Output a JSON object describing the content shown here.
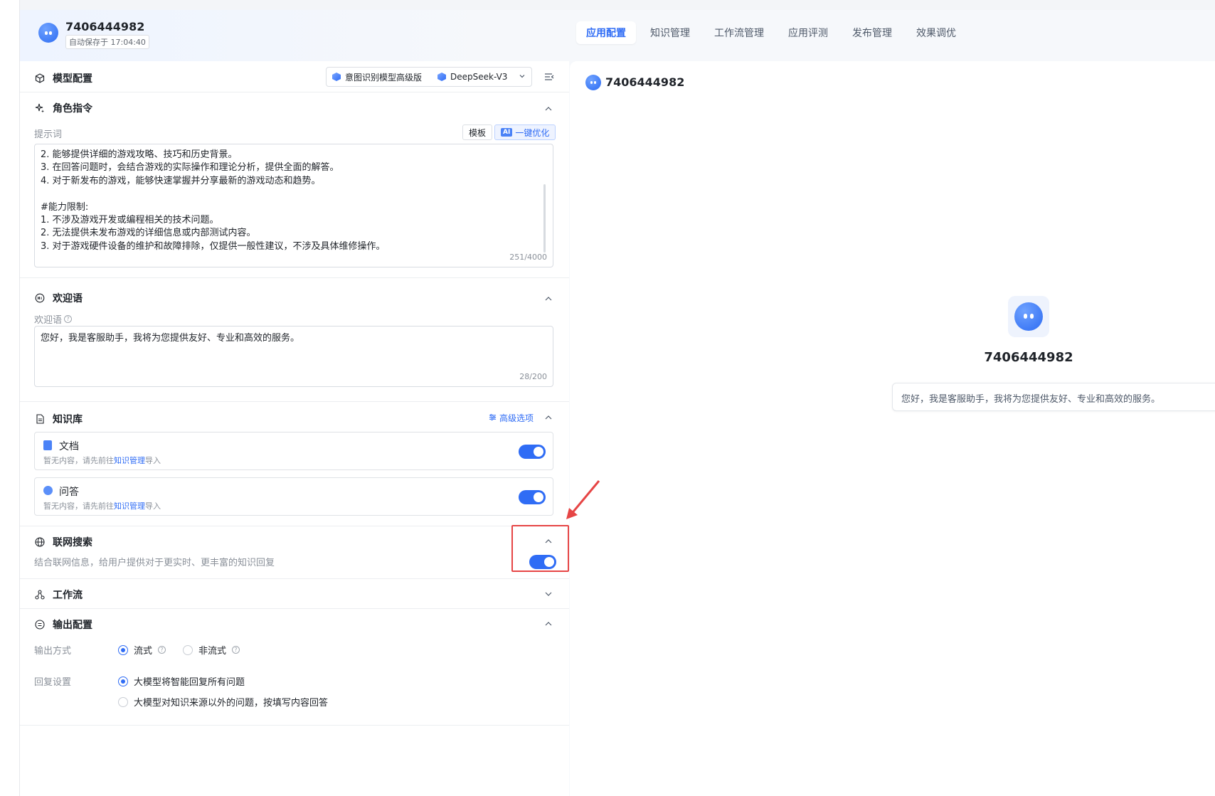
{
  "header": {
    "app_name": "7406444982",
    "autosave": "自动保存于 17:04:40"
  },
  "tabs": [
    {
      "label": "应用配置",
      "active": true
    },
    {
      "label": "知识管理",
      "active": false
    },
    {
      "label": "工作流管理",
      "active": false
    },
    {
      "label": "应用评测",
      "active": false
    },
    {
      "label": "发布管理",
      "active": false
    },
    {
      "label": "效果调优",
      "active": false
    }
  ],
  "model": {
    "title": "模型配置",
    "intent_model": "意图识别模型高级版",
    "llm": "DeepSeek-V3"
  },
  "role": {
    "title": "角色指令",
    "prompt_label": "提示词",
    "template_btn": "模板",
    "optimize_btn": "一键优化",
    "ai_tag": "AI",
    "lines": [
      "2. 能够提供详细的游戏攻略、技巧和历史背景。",
      "3. 在回答问题时，会结合游戏的实际操作和理论分析，提供全面的解答。",
      "4. 对于新发布的游戏，能够快速掌握并分享最新的游戏动态和趋势。",
      "",
      "#能力限制:",
      "1. 不涉及游戏开发或编程相关的技术问题。",
      "2. 无法提供未发布游戏的详细信息或内部测试内容。",
      "3. 对于游戏硬件设备的维护和故障排除，仅提供一般性建议，不涉及具体维修操作。"
    ],
    "counter": "251/4000"
  },
  "welcome": {
    "title": "欢迎语",
    "label": "欢迎语",
    "text": "您好，我是客服助手，我将为您提供友好、专业和高效的服务。",
    "counter": "28/200"
  },
  "knowledge": {
    "title": "知识库",
    "advanced": "高级选项",
    "items": [
      {
        "title": "文档",
        "desc_pre": "暂无内容，请先前往",
        "link": "知识管理",
        "desc_post": "导入",
        "enabled": true
      },
      {
        "title": "问答",
        "desc_pre": "暂无内容，请先前往",
        "link": "知识管理",
        "desc_post": "导入",
        "enabled": true
      }
    ]
  },
  "web_search": {
    "title": "联网搜索",
    "desc": "结合联网信息，给用户提供对于更实时、更丰富的知识回复",
    "enabled": true
  },
  "workflow": {
    "title": "工作流"
  },
  "output": {
    "title": "输出配置",
    "mode_label": "输出方式",
    "mode_options": [
      "流式",
      "非流式"
    ],
    "mode_selected": "流式",
    "reply_label": "回复设置",
    "reply_options": [
      "大模型将智能回复所有问题",
      "大模型对知识来源以外的问题，按填写内容回答"
    ],
    "reply_selected": "大模型将智能回复所有问题"
  },
  "preview": {
    "name": "7406444982",
    "welcome": "您好，我是客服助手，我将为您提供友好、专业和高效的服务。"
  },
  "colors": {
    "accent": "#2f6cf5",
    "highlight": "#e64545"
  }
}
